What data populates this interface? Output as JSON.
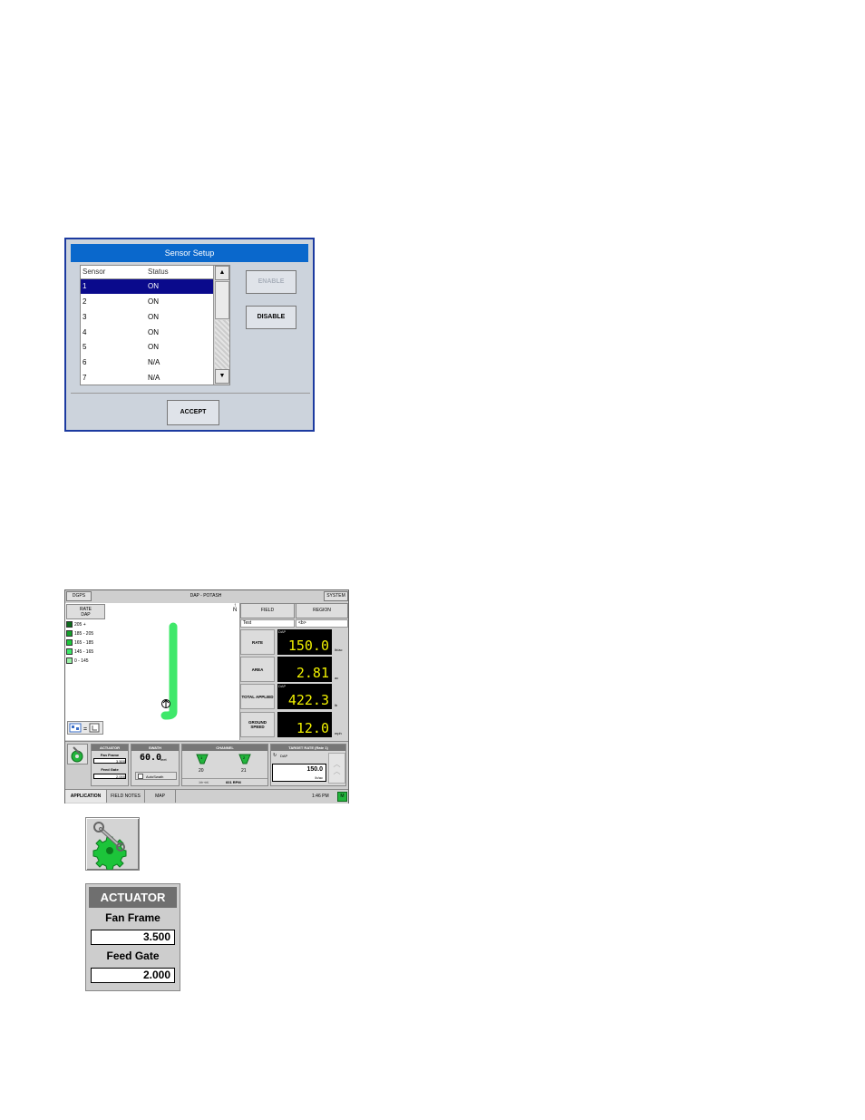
{
  "sensor_setup": {
    "title": "Sensor Setup",
    "columns": [
      "Sensor",
      "Status"
    ],
    "rows": [
      {
        "sensor": "1",
        "status": "ON"
      },
      {
        "sensor": "2",
        "status": "ON"
      },
      {
        "sensor": "3",
        "status": "ON"
      },
      {
        "sensor": "4",
        "status": "ON"
      },
      {
        "sensor": "5",
        "status": "ON"
      },
      {
        "sensor": "6",
        "status": "N/A"
      },
      {
        "sensor": "7",
        "status": "N/A"
      }
    ],
    "enable_label": "ENABLE",
    "disable_label": "DISABLE",
    "accept_label": "ACCEPT"
  },
  "main_screen": {
    "topbar": {
      "left": "DGPS",
      "center": "DAP - POTASH",
      "right": "SYSTEM"
    },
    "rate_button": {
      "line1": "RATE",
      "line2": "DAP"
    },
    "north_label": "N",
    "legend": [
      {
        "label": "205 +",
        "color": "#0c6b1c"
      },
      {
        "label": "185 - 205",
        "color": "#15a02c"
      },
      {
        "label": "165 - 185",
        "color": "#1ec83c"
      },
      {
        "label": "145 - 165",
        "color": "#3fe86a"
      },
      {
        "label": "0 - 145",
        "color": "#9af0a6"
      }
    ],
    "field_label": "FIELD",
    "region_label": "REGION",
    "field_value": "Test",
    "region_value": "<b>",
    "metrics": [
      {
        "label": "RATE",
        "tag": "DAP",
        "value": "150.0",
        "unit": "lb/ac"
      },
      {
        "label": "AREA",
        "tag": "",
        "value": "2.81",
        "unit": "ac"
      },
      {
        "label": "TOTAL APPLIED",
        "tag": "DAP",
        "value": "422.3",
        "unit": "lb"
      },
      {
        "label": "GROUND SPEED",
        "tag": "",
        "value": "12.0",
        "unit": "mph"
      }
    ],
    "actuator": {
      "title": "ACTUATOR",
      "fan_frame_label": "Fan Frame",
      "fan_frame_value": "3.500",
      "feed_gate_label": "Feed Gate",
      "feed_gate_value": "2.000"
    },
    "swath": {
      "title": "SWATH",
      "value": "60.0",
      "unit": "feet",
      "autoswath_label": "AutoSwath"
    },
    "channel": {
      "title": "CHANNEL",
      "ch1": "1",
      "ch2": "2",
      "ch1_value": "20",
      "ch2_value": "21",
      "rpm": "601 RPM"
    },
    "target_rate": {
      "title": "TARGET RATE (Rate 1)",
      "product": "DAP",
      "value": "150.0",
      "unit": "lb/ac"
    },
    "tabs": [
      "APPLICATION",
      "FIELD NOTES",
      "MAP"
    ],
    "time": "1:46 PM",
    "status_indicator": "M"
  },
  "actuator_enlarged": {
    "title": "ACTUATOR",
    "fan_frame_label": "Fan Frame",
    "fan_frame_value": "3.500",
    "feed_gate_label": "Feed Gate",
    "feed_gate_value": "2.000"
  },
  "icons": {
    "setup_icon": "gear-wrench-icon"
  }
}
